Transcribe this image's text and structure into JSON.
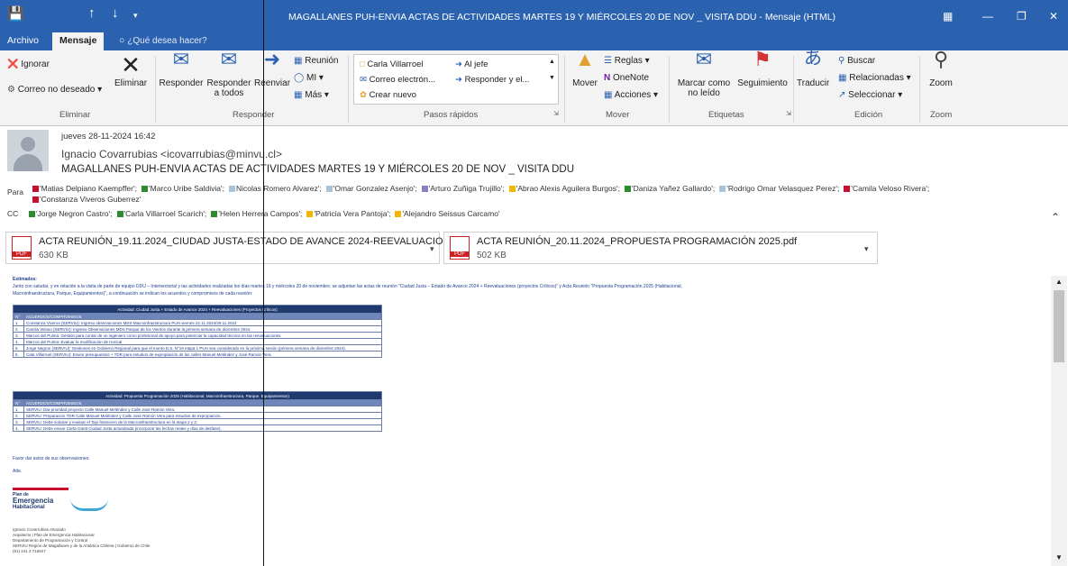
{
  "window": {
    "title": "MAGALLANES PUH-ENVIA ACTAS DE ACTIVIDADES MARTES 19 Y MIÉRCOLES 20 DE NOV _ VISITA DDU - Mensaje (HTML)"
  },
  "tabs": {
    "archivo": "Archivo",
    "mensaje": "Mensaje",
    "tellme": "¿Qué desea hacer?"
  },
  "ribbon": {
    "ignorar": "Ignorar",
    "correo_no_deseado": "Correo no deseado",
    "eliminar": "Eliminar",
    "grp_eliminar": "Eliminar",
    "responder": "Responder",
    "responder_a_todos": "Responder a todos",
    "reenviar": "Reenviar",
    "reunion": "Reunión",
    "mi": "MI",
    "mas": "Más",
    "grp_responder": "Responder",
    "qs_carla": "Carla Villarroel",
    "qs_correo": "Correo electrón...",
    "qs_crear": "Crear nuevo",
    "qs_jefe": "Al jefe",
    "qs_responder": "Responder y el...",
    "grp_pasos": "Pasos rápidos",
    "mover": "Mover",
    "reglas": "Reglas",
    "onenote": "OneNote",
    "acciones": "Acciones",
    "grp_mover": "Mover",
    "marcar": "Marcar como no leído",
    "seguimiento": "Seguimiento",
    "grp_etiquetas": "Etiquetas",
    "traducir": "Traducir",
    "buscar": "Buscar",
    "relacionadas": "Relacionadas",
    "seleccionar": "Seleccionar",
    "grp_edicion": "Edición",
    "zoom": "Zoom",
    "grp_zoom": "Zoom"
  },
  "message": {
    "date": "jueves 28-11-2024 16:42",
    "sender": "Ignacio Covarrubias <icovarrubias@minvu.cl>",
    "subject": "MAGALLANES PUH-ENVIA ACTAS DE ACTIVIDADES MARTES 19 Y MIÉRCOLES 20 DE NOV _ VISITA DDU",
    "para_label": "Para",
    "cc_label": "CC",
    "para": [
      {
        "name": "'Matias Delpiano Kaempffer';",
        "color": "#c8102e"
      },
      {
        "name": "'Marco Uribe Saldivia';",
        "color": "#2e8b2e"
      },
      {
        "name": "Nicolas Romero Alvarez';",
        "color": "#a9c4d8"
      },
      {
        "name": "'Omar Gonzalez Asenjo';",
        "color": "#a9c4d8"
      },
      {
        "name": "'Arturo Zuñiga Trujillo';",
        "color": "#8a7fc0"
      },
      {
        "name": "'Abrao Alexis Aguilera Burgos';",
        "color": "#f2b705"
      },
      {
        "name": "'Daniza Yañez Gallardo';",
        "color": "#2e8b2e"
      },
      {
        "name": "'Rodrigo Omar Velasquez Perez';",
        "color": "#a9c4d8"
      },
      {
        "name": "'Camila Veloso Rivera';",
        "color": "#c8102e"
      }
    ],
    "para_line2": {
      "name": "'Constanza Viveros Guberrez'",
      "color": "#c8102e"
    },
    "cc": [
      {
        "name": "'Jorge Negron Castro';",
        "color": "#2e8b2e"
      },
      {
        "name": "'Carla Villarroel Scarich';",
        "color": "#2e8b2e"
      },
      {
        "name": "'Helen Herrera Campos';",
        "color": "#2e8b2e"
      },
      {
        "name": "'Patricia Vera Pantoja';",
        "color": "#f2b705"
      },
      {
        "name": "'Alejandro Seissus Carcamo'",
        "color": "#f2b705"
      }
    ]
  },
  "attachments": [
    {
      "name": "ACTA REUNIÓN_19.11.2024_CIUDAD JUSTA-ESTADO DE AVANCE 2024-REEVALUACIONES.pdf",
      "size": "630 KB"
    },
    {
      "name": "ACTA REUNIÓN_20.11.2024_PROPUESTA PROGRAMACIÓN 2025.pdf",
      "size": "502 KB"
    }
  ],
  "body": {
    "greeting": "Estimados:",
    "p1": "Junto con saludar, y en relación a la visita de parte de equipo DDU – Intersectorial y las actividades realizadas los días martes 19 y miércoles 20 de noviembre, se adjuntan las actas de reunión \"Ciudad Justa – Estado de Avance 2024 + Reevaluaciones (proyectos Críticos)\" y Acta Reunión \"Propuesta Programación 2025 (Habitacional,",
    "p1b": "Macroinfraestructura, Parque, Equipamientos)\", a continuación se indican los acuerdos y compromisos de cada reunión:",
    "t1_title": "Actividad: Ciudad Justa + Estado de Avance 2024 + Reevaluaciones (Proyectos Críticos)",
    "t1_header": "ACUERDOS/COMPROMISOS",
    "t1_rows": [
      "Constanza Viveros (SERVIU): Ingreso observaciones MDS Macroinfraestructura PUH viernes 22.11.2024/29.11.2024",
      "Camila Veloso (SERVIU): Ingreso Observaciones MDS Parque de los Vientos durante la primera semana de diciembre 2024.",
      "Marcos del Pulma: Gestión para contar de un ingeniero como profesional de apoyo para potenciar la capacidad técnica en las reevaluaciones.",
      "Marcos del Pulma: Evaluar la modificación de Horical",
      "Jorge Negron (SERVIU): Gestiones en Gobierno Regional para que el monto D.S. N°19 etapa 1 PUH sea considerado en la próxima sesión (primera semana de diciembre 2024).",
      "Cata Villarroel (SERVIU): Enviar presupuestos + TDR para estudios de expropiación de las calles Manuel Meléndez y José Ramón Vera."
    ],
    "t2_title": "Actividad: Propuesta Programación 2025 (Habitacional, Macroinfraestructura, Parque, Equipamientos)",
    "t2_header": "ACUERDOS/COMPROMISOS",
    "t2_rows": [
      "SERVIU: Dar prioridad proyecto Calle Manuel Meléndez y Calle José Ramón Vera.",
      "SERVIU: Preparación TDR Calle Manuel Meléndez y Calle José Ramón Vera para estudios de expropiación.",
      "SERVIU: Debe solicitar y evaluar el Tajo financiero de la Macroinfraestructura en la etapa 2 y 3.",
      "SERVIU: Debe enviar Carta Gantt Ciudad Justa actualizada (incorporar las fechas reales y días de desfase)."
    ],
    "closing": "Favor dar aviso de sus observaciones.",
    "atte": "Atte.",
    "logo_line1": "Plan de",
    "logo_line2": "Emergencia",
    "logo_line3": "Habitacional",
    "sig": [
      "Ignacio Covarrubias Alvarado",
      "Arquitecto | Plan de Emergencia Habitacional",
      "Departamento de Programación y Control",
      "SERVIU Región de Magallanes y de la Antártica Chilena | Gobierno de Chile",
      "(61) 241 2 716627"
    ]
  },
  "colors": {
    "titlebar": "#2b62b0",
    "ribbon": "#f3f3f3",
    "table_header": "#1f3a6e"
  }
}
